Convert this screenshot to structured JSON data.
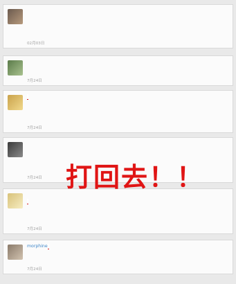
{
  "comments": [
    {
      "username": "",
      "lines": [
        "",
        "",
        "",
        "",
        ""
      ],
      "time": "02月03日",
      "reply_label": "",
      "like_label": ""
    },
    {
      "username": "",
      "lines": [
        "",
        "",
        ""
      ],
      "time": "7月24日",
      "highlight": "",
      "reply_label": "",
      "like_label": ""
    },
    {
      "username": "",
      "lines": [
        "",
        "",
        "",
        "",
        ""
      ],
      "time": "7月24日",
      "highlight": "",
      "reply_label": "",
      "like_label": ""
    },
    {
      "username": "",
      "lines": [
        "",
        "",
        "",
        "",
        "",
        ""
      ],
      "time": "7月24日",
      "reply_label": "",
      "like_label": ""
    },
    {
      "username": "",
      "lines": [
        "",
        "",
        "",
        "",
        ""
      ],
      "time": "7月24日",
      "highlight": "",
      "reply_label": "",
      "like_label": ""
    },
    {
      "username": "morphine",
      "lines": [
        "",
        "",
        ""
      ],
      "time": "7月24日",
      "highlight": "",
      "reply_label": "",
      "like_label": ""
    }
  ],
  "overlay_text": "打回去！！",
  "watermark": ""
}
